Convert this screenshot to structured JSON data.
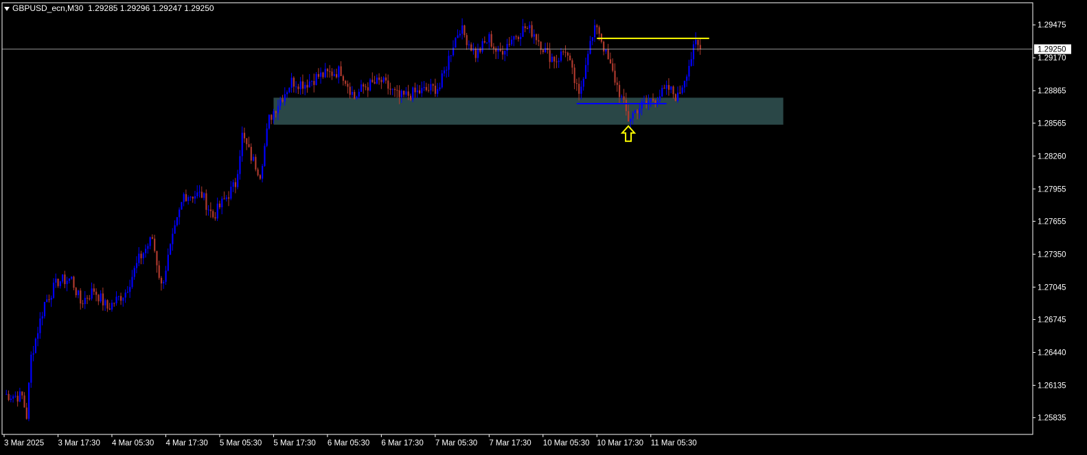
{
  "header": {
    "symbol": "GBPUSD_ecn,M30",
    "ohlc": "1.29285 1.29296 1.29247 1.29250"
  },
  "colors": {
    "background": "#000000",
    "axis": "#ffffff",
    "bull": "#0000ff",
    "bear": "#b03a2e",
    "zone": "#2f4f4f",
    "resistance": "#ffff00",
    "support": "#0000ff",
    "price_line": "#c0c0c0",
    "arrow": "#ffff00"
  },
  "chart_data": {
    "type": "candlestick",
    "symbol": "GBPUSD_ecn",
    "timeframe": "M30",
    "last_price": 1.2925,
    "last_price_label": "1.29250",
    "ylim": [
      1.2568,
      1.2968
    ],
    "y_ticks": [
      {
        "value": 1.29475,
        "label": "1.29475"
      },
      {
        "value": 1.2917,
        "label": "1.29170"
      },
      {
        "value": 1.28865,
        "label": "1.28865"
      },
      {
        "value": 1.28565,
        "label": "1.28565"
      },
      {
        "value": 1.2826,
        "label": "1.28260"
      },
      {
        "value": 1.27955,
        "label": "1.27955"
      },
      {
        "value": 1.27655,
        "label": "1.27655"
      },
      {
        "value": 1.2735,
        "label": "1.27350"
      },
      {
        "value": 1.27045,
        "label": "1.27045"
      },
      {
        "value": 1.26745,
        "label": "1.26745"
      },
      {
        "value": 1.2644,
        "label": "1.26440"
      },
      {
        "value": 1.26135,
        "label": "1.26135"
      },
      {
        "value": 1.25835,
        "label": "1.25835"
      }
    ],
    "x_ticks": [
      {
        "bar": 0,
        "label": "3 Mar 2025"
      },
      {
        "bar": 24,
        "label": "3 Mar 17:30"
      },
      {
        "bar": 48,
        "label": "4 Mar 05:30"
      },
      {
        "bar": 72,
        "label": "4 Mar 17:30"
      },
      {
        "bar": 96,
        "label": "5 Mar 05:30"
      },
      {
        "bar": 120,
        "label": "5 Mar 17:30"
      },
      {
        "bar": 144,
        "label": "6 Mar 05:30"
      },
      {
        "bar": 168,
        "label": "6 Mar 17:30"
      },
      {
        "bar": 192,
        "label": "7 Mar 05:30"
      },
      {
        "bar": 216,
        "label": "7 Mar 17:30"
      },
      {
        "bar": 240,
        "label": "10 Mar 05:30"
      },
      {
        "bar": 264,
        "label": "10 Mar 17:30"
      },
      {
        "bar": 288,
        "label": "11 Mar 05:30"
      }
    ],
    "price_path": [
      [
        0,
        1.2605
      ],
      [
        8,
        1.2603
      ],
      [
        10,
        1.2585
      ],
      [
        12,
        1.264
      ],
      [
        18,
        1.269
      ],
      [
        24,
        1.271
      ],
      [
        30,
        1.2712
      ],
      [
        34,
        1.269
      ],
      [
        40,
        1.2702
      ],
      [
        46,
        1.2685
      ],
      [
        54,
        1.27
      ],
      [
        60,
        1.273
      ],
      [
        66,
        1.275
      ],
      [
        70,
        1.2705
      ],
      [
        74,
        1.274
      ],
      [
        80,
        1.279
      ],
      [
        88,
        1.279
      ],
      [
        93,
        1.277
      ],
      [
        98,
        1.2785
      ],
      [
        103,
        1.28
      ],
      [
        106,
        1.2845
      ],
      [
        110,
        1.2825
      ],
      [
        114,
        1.281
      ],
      [
        118,
        1.286
      ],
      [
        122,
        1.2875
      ],
      [
        128,
        1.2895
      ],
      [
        134,
        1.2893
      ],
      [
        140,
        1.29
      ],
      [
        150,
        1.2905
      ],
      [
        156,
        1.288
      ],
      [
        160,
        1.289
      ],
      [
        168,
        1.2895
      ],
      [
        176,
        1.288
      ],
      [
        184,
        1.2885
      ],
      [
        194,
        1.289
      ],
      [
        200,
        1.293
      ],
      [
        203,
        1.2945
      ],
      [
        210,
        1.292
      ],
      [
        216,
        1.2935
      ],
      [
        220,
        1.292
      ],
      [
        226,
        1.2935
      ],
      [
        232,
        1.2945
      ],
      [
        236,
        1.294
      ],
      [
        242,
        1.292
      ],
      [
        246,
        1.2915
      ],
      [
        250,
        1.2925
      ],
      [
        254,
        1.2895
      ],
      [
        256,
        1.288
      ],
      [
        260,
        1.2925
      ],
      [
        262,
        1.2935
      ],
      [
        264,
        1.2948
      ],
      [
        268,
        1.292
      ],
      [
        274,
        1.2885
      ],
      [
        278,
        1.286
      ],
      [
        282,
        1.287
      ],
      [
        286,
        1.2875
      ],
      [
        290,
        1.288
      ],
      [
        296,
        1.2888
      ],
      [
        300,
        1.288
      ],
      [
        304,
        1.2905
      ],
      [
        308,
        1.293
      ],
      [
        310,
        1.2925
      ]
    ],
    "zone": {
      "from_bar": 120,
      "to_bar": 347,
      "top": 1.288,
      "bottom": 1.2855
    },
    "resistance_line": {
      "from_bar": 264,
      "to_bar": 314,
      "value": 1.2935
    },
    "support_line": {
      "from_bar": 255,
      "to_bar": 295,
      "value": 1.28745
    },
    "arrow_marker": {
      "bar": 278,
      "value": 1.2855
    }
  }
}
